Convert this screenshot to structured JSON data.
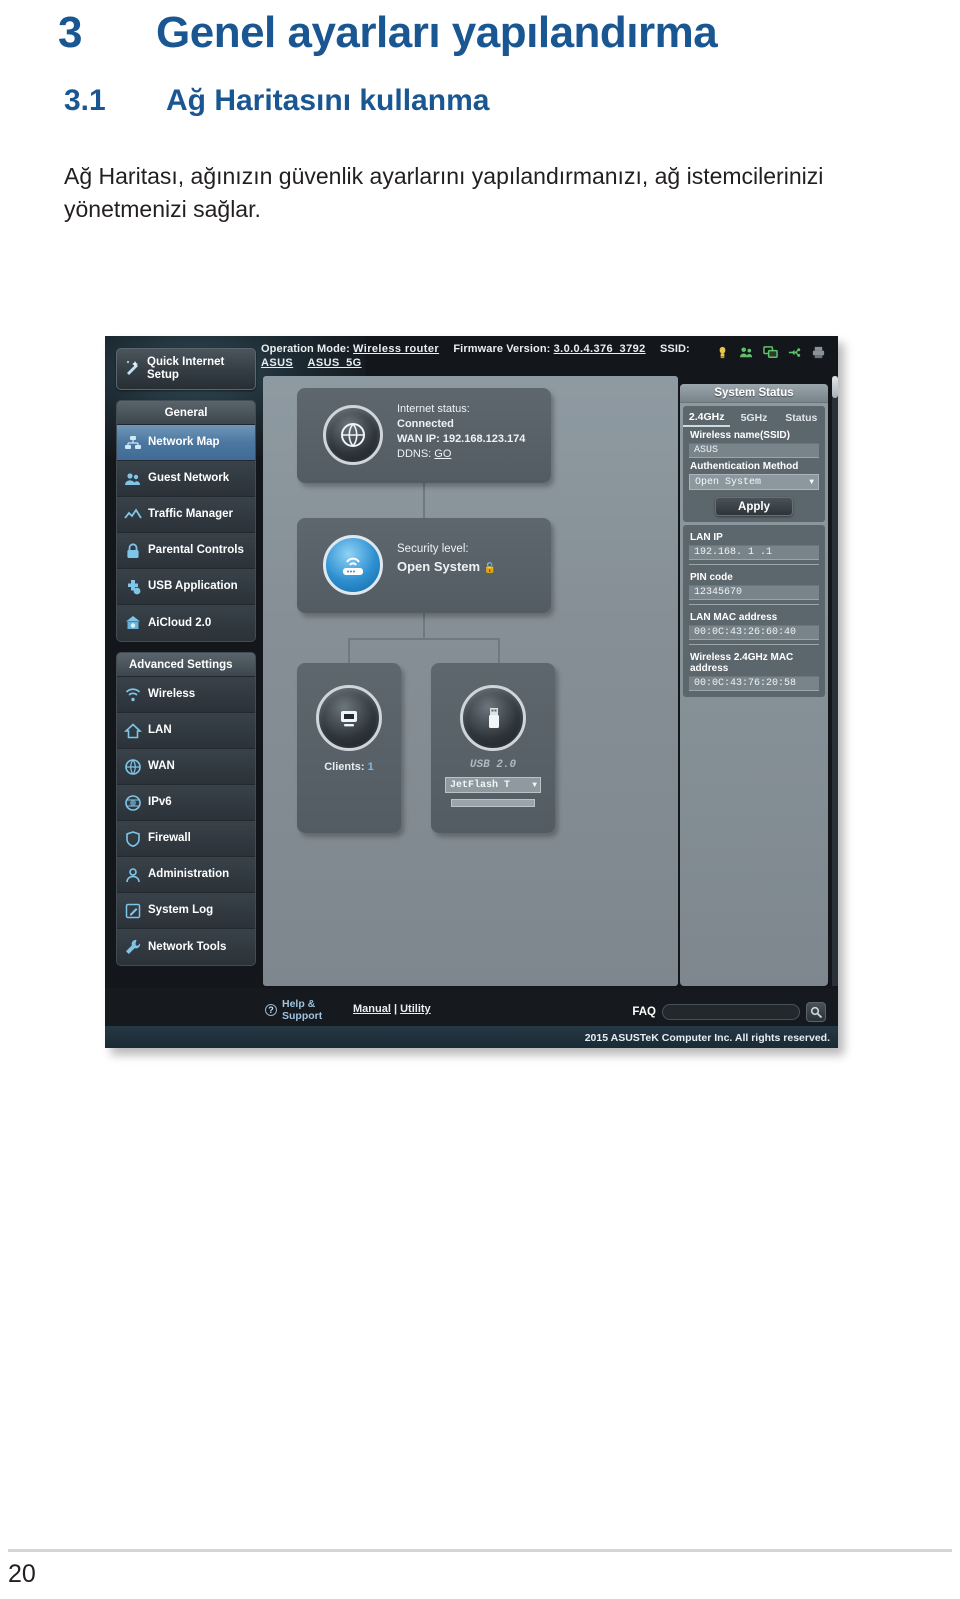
{
  "document": {
    "chapter_number": "3",
    "chapter_title": "Genel ayarları yapılandırma",
    "section_number": "3.1",
    "section_title": "Ağ Haritasını kullanma",
    "body": "Ağ Haritası, ağınızın güvenlik ayarlarını yapılandırmanızı, ağ istemcilerinizi yönetmenizi sağlar.",
    "page_number": "20"
  },
  "router_ui": {
    "topbar": {
      "operation_mode_label": "Operation Mode:",
      "operation_mode_value": "Wireless router",
      "firmware_label": "Firmware Version:",
      "firmware_value": "3.0.0.4.376_3792",
      "ssid_label": "SSID:",
      "ssid_value_1": "ASUS",
      "ssid_value_2": "ASUS_5G",
      "icons": [
        {
          "name": "lamp-icon",
          "color": "#e8c84a"
        },
        {
          "name": "users-icon",
          "color": "#5fbf6a"
        },
        {
          "name": "monitors-icon",
          "color": "#5fbf6a"
        },
        {
          "name": "usb-icon",
          "color": "#5fbf6a"
        },
        {
          "name": "printer-icon",
          "color": "#8a9299"
        }
      ]
    },
    "sidebar": {
      "quick_setup": "Quick Internet Setup",
      "general_header": "General",
      "general_items": [
        {
          "label": "Network Map",
          "icon": "network-map-icon",
          "active": true
        },
        {
          "label": "Guest Network",
          "icon": "guest-network-icon",
          "active": false
        },
        {
          "label": "Traffic Manager",
          "icon": "traffic-manager-icon",
          "active": false
        },
        {
          "label": "Parental Controls",
          "icon": "lock-icon",
          "active": false
        },
        {
          "label": "USB Application",
          "icon": "usb-application-icon",
          "active": false
        },
        {
          "label": "AiCloud 2.0",
          "icon": "aicloud-icon",
          "active": false
        }
      ],
      "advanced_header": "Advanced Settings",
      "advanced_items": [
        {
          "label": "Wireless",
          "icon": "wifi-icon"
        },
        {
          "label": "LAN",
          "icon": "home-icon"
        },
        {
          "label": "WAN",
          "icon": "globe-icon"
        },
        {
          "label": "IPv6",
          "icon": "ipv6-globe-icon"
        },
        {
          "label": "Firewall",
          "icon": "shield-icon"
        },
        {
          "label": "Administration",
          "icon": "user-icon"
        },
        {
          "label": "System Log",
          "icon": "log-pencil-icon"
        },
        {
          "label": "Network Tools",
          "icon": "wrench-icon"
        }
      ]
    },
    "map": {
      "internet": {
        "status_label": "Internet status:",
        "status_value": "Connected",
        "wan_ip": "WAN IP: 192.168.123.174",
        "ddns_label": "DDNS:",
        "ddns_value": "GO"
      },
      "security": {
        "label": "Security level:",
        "value": "Open System"
      },
      "clients": {
        "label": "Clients:",
        "count": "1"
      },
      "usb": {
        "label": "USB 2.0",
        "device": "JetFlash T",
        "has_bar": true
      }
    },
    "status_panel": {
      "title": "System Status",
      "tabs": [
        {
          "label": "2.4GHz",
          "active": true
        },
        {
          "label": "5GHz",
          "active": false
        },
        {
          "label": "Status",
          "active": false
        }
      ],
      "ssid_label": "Wireless name(SSID)",
      "ssid_value": "ASUS",
      "auth_label": "Authentication Method",
      "auth_value": "Open System",
      "apply_label": "Apply",
      "fields": [
        {
          "label": "LAN IP",
          "value": "192.168. 1 .1"
        },
        {
          "label": "PIN code",
          "value": "12345670"
        },
        {
          "label": "LAN MAC address",
          "value": "00:0C:43:26:60:40"
        },
        {
          "label": "Wireless 2.4GHz MAC address",
          "value": "00:0C:43:76:20:58"
        }
      ]
    },
    "footer": {
      "help_line1": "Help &",
      "help_line2": "Support",
      "manual": "Manual",
      "divider": "|",
      "utility": "Utility",
      "faq_label": "FAQ",
      "faq_value": "",
      "faq_placeholder": "",
      "copyright": "2015 ASUSTeK Computer Inc. All rights reserved."
    }
  },
  "colors": {
    "heading_blue": "#1a5792",
    "accent_blue": "#7fb8e6",
    "nav_active": "#4c77a0"
  }
}
